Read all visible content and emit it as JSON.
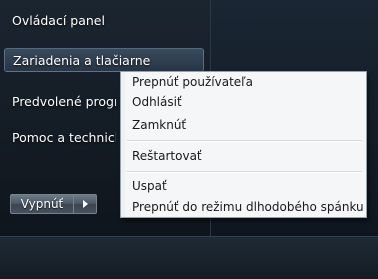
{
  "start_menu": {
    "places": [
      {
        "label": "Ovládací panel"
      },
      {
        "label": "Zariadenia a tlačiarne"
      },
      {
        "label": "Predvolené programy"
      },
      {
        "label": "Pomoc a technická podpora"
      }
    ],
    "shutdown_label": "Vypnúť"
  },
  "shutdown_menu": {
    "items": [
      {
        "label": "Prepnúť používateľa"
      },
      {
        "label": "Odhlásiť"
      },
      {
        "label": "Zamknúť"
      },
      {
        "label": "Reštartovať"
      },
      {
        "label": "Uspať"
      },
      {
        "label": "Prepnúť do režimu dlhodobého spánku"
      }
    ]
  }
}
